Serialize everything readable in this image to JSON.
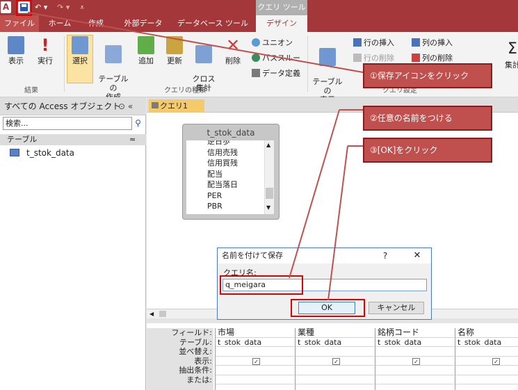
{
  "qat": {
    "logo": "A",
    "undo": "↶ ▾",
    "redo": "↷ ▾",
    "customize": "⩡"
  },
  "context_tab": "クエリ ツール",
  "tabs": [
    {
      "label": "ファイル"
    },
    {
      "label": "ホーム"
    },
    {
      "label": "作成"
    },
    {
      "label": "外部データ"
    },
    {
      "label": "データベース ツール"
    },
    {
      "label": "デザイン"
    }
  ],
  "ribbon": {
    "view": "表示",
    "run": "実行",
    "select": "選択",
    "make_table": "テーブルの\n作成",
    "append": "追加",
    "update": "更新",
    "crosstab": "クロス\n集計",
    "delete": "削除",
    "union": "ユニオン",
    "passthrough": "パススルー",
    "data_def": "データ定義",
    "show_table": "テーブルの\n表示",
    "insert_row": "行の挿入",
    "delete_row": "行の削除",
    "insert_col": "列の挿入",
    "delete_col": "列の削除",
    "totals": "集計",
    "group_results": "結果",
    "group_query_type": "クエリの種類",
    "group_query_setup": "クエリ設定"
  },
  "nav": {
    "header": "すべての Access オブジェクト",
    "header_icons": "⊙ «",
    "search_placeholder": "検索...",
    "section": "テーブル",
    "section_toggle": "≈",
    "items": [
      {
        "label": "t_stok_data"
      }
    ]
  },
  "query_tab": "クエリ1",
  "table_box": {
    "title": "t_stok_data",
    "fields": [
      "逆日歩",
      "信用売残",
      "信用買残",
      "配当",
      "配当落日",
      "PER",
      "PBR"
    ]
  },
  "grid": {
    "row_labels": [
      "フィールド:",
      "テーブル:",
      "並べ替え:",
      "表示:",
      "抽出条件:",
      "または:"
    ],
    "columns": [
      {
        "field": "市場",
        "table": "t_stok_data"
      },
      {
        "field": "業種",
        "table": "t_stok_data"
      },
      {
        "field": "銘柄コード",
        "table": "t_stok_data"
      },
      {
        "field": "名称",
        "table": "t_stok_data"
      }
    ],
    "check": "✓"
  },
  "dialog": {
    "title": "名前を付けて保存",
    "help": "?",
    "close": "✕",
    "label": "クエリ名:",
    "value": "q_meigara",
    "ok": "OK",
    "cancel": "キャンセル"
  },
  "annotations": [
    {
      "text": "①保存アイコンをクリック"
    },
    {
      "text": "②任意の名前をつける"
    },
    {
      "text": "③[OK]をクリック"
    }
  ]
}
